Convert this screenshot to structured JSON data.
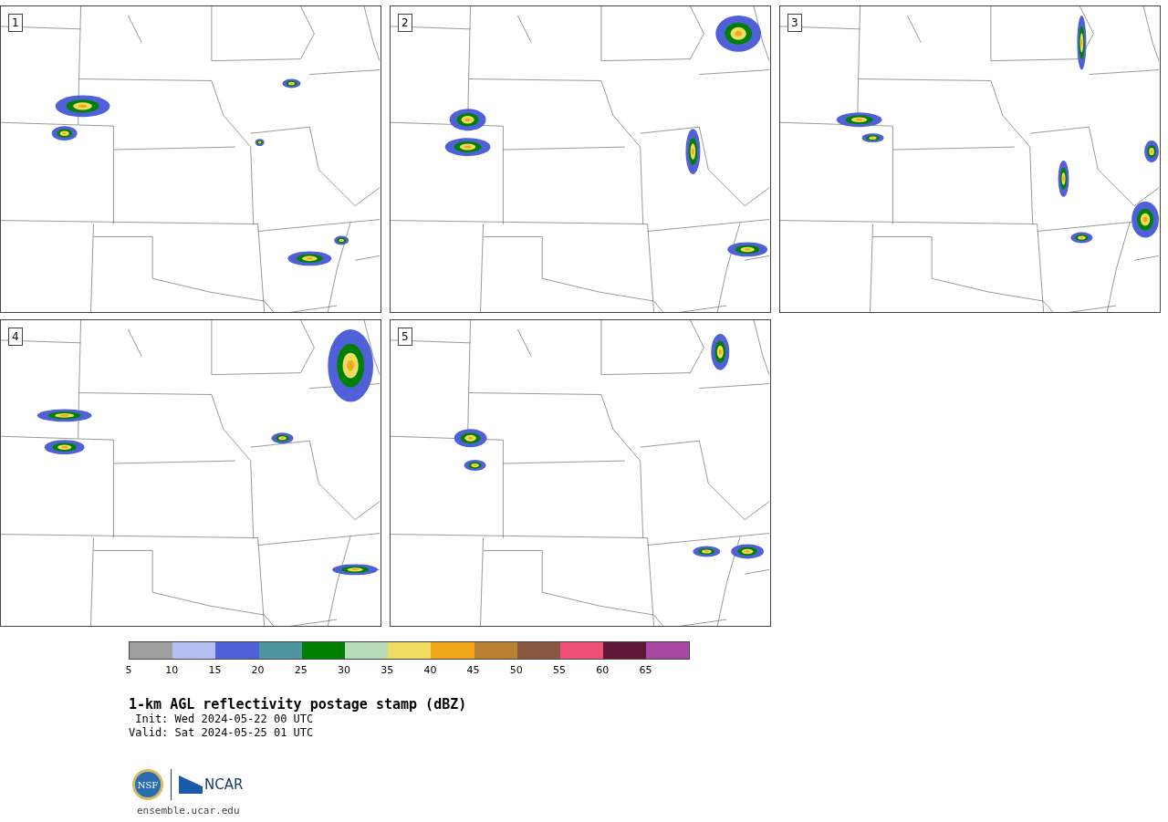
{
  "panels": [
    {
      "label": "1"
    },
    {
      "label": "2"
    },
    {
      "label": "3"
    },
    {
      "label": "4"
    },
    {
      "label": "5"
    }
  ],
  "colorbar": {
    "bins": [
      {
        "color": "#a0a0a0",
        "tick": "5"
      },
      {
        "color": "#b4bef0",
        "tick": "10"
      },
      {
        "color": "#5060d8",
        "tick": "15"
      },
      {
        "color": "#50969e",
        "tick": "20"
      },
      {
        "color": "#008000",
        "tick": "25"
      },
      {
        "color": "#b8dcb8",
        "tick": "30"
      },
      {
        "color": "#f0dc60",
        "tick": "35"
      },
      {
        "color": "#f0a818",
        "tick": "40"
      },
      {
        "color": "#b88030",
        "tick": "45"
      },
      {
        "color": "#885840",
        "tick": "50"
      },
      {
        "color": "#f05078",
        "tick": "55"
      },
      {
        "color": "#601838",
        "tick": "60"
      },
      {
        "color": "#a848a0",
        "tick": "65"
      }
    ]
  },
  "title": "1-km AGL reflectivity postage stamp (dBZ)",
  "init": "Init: Wed 2024-05-22 00 UTC",
  "valid": "Valid: Sat 2024-05-25 01 UTC",
  "logo": {
    "nsf": "NSF",
    "ncar": "NCAR"
  },
  "footer": "ensemble.ucar.edu"
}
